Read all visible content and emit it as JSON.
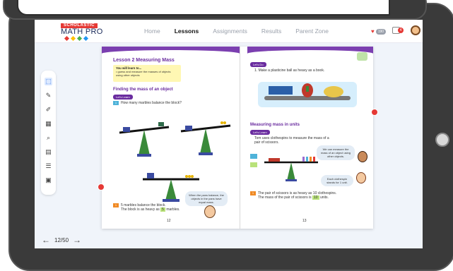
{
  "brand": {
    "publisher": "SCHOLASTIC",
    "product": "MATH PRO",
    "dot_colors": [
      "#e53935",
      "#ffc107",
      "#4caf50",
      "#2196f3"
    ]
  },
  "nav": {
    "items": [
      "Home",
      "Lessons",
      "Assignments",
      "Results",
      "Parent Zone"
    ],
    "active": "Lessons"
  },
  "header": {
    "hearts_count": "190",
    "notifications_count": "4"
  },
  "tools": [
    "select-icon",
    "pencil-icon",
    "highlighter-icon",
    "table-icon",
    "zoom-icon",
    "calculator-icon",
    "abacus-icon",
    "ruler-icon"
  ],
  "left_page": {
    "lesson_title": "Lesson 2   Measuring Mass",
    "learn_heading": "You will learn to...",
    "learn_points": [
      "• guess and measure the masses of objects",
      "  using other objects"
    ],
    "section_title": "Finding the mass of an object",
    "lets_learn": "Let's Learn",
    "question_num": "1",
    "question": "How many marbles balance the block?",
    "bubble": "When the pans balance, the objects in the pans have equal mass.",
    "answer_num": "1",
    "answer_line1": "5 marbles balance the block.",
    "answer_line2": "The block is as heavy as",
    "answer_blank": "5",
    "answer_tail": "marbles.",
    "page_number": "12"
  },
  "right_page": {
    "lets_do": "Let's Do",
    "task_num": "1.",
    "task": "Make a plasticine ball as heavy as a book.",
    "section_title": "Measuring mass in units",
    "lets_learn": "Let's Learn",
    "body_line1": "Tom uses clothespins to measure the mass of a",
    "body_line2": "pair of scissors.",
    "bubble_top": "We can measure the mass of an object using other objects.",
    "bubble_bottom": "Each clothespin stands for 1 unit.",
    "answer_num": "1",
    "answer_line1": "The pair of scissors is as heavy as 10 clothespins.",
    "answer_line2": "The mass of the pair of scissors is",
    "answer_blank": "10",
    "answer_tail": "units.",
    "page_number": "13"
  },
  "pager": {
    "prev": "←",
    "next": "→",
    "label": "12/50"
  }
}
